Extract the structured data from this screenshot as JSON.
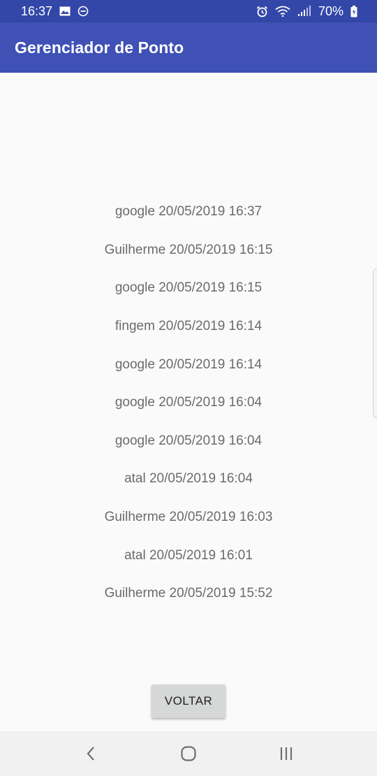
{
  "status_bar": {
    "time": "16:37",
    "battery": "70%",
    "icons": [
      "gallery-icon",
      "do-not-disturb-icon",
      "alarm-icon",
      "wifi-icon",
      "signal-icon",
      "battery-icon"
    ]
  },
  "app_bar": {
    "title": "Gerenciador de Ponto",
    "color": "#3f51b5"
  },
  "records": [
    "google 20/05/2019 16:37",
    "Guilherme 20/05/2019 16:15",
    "google 20/05/2019 16:15",
    "fingem 20/05/2019 16:14",
    "google 20/05/2019 16:14",
    "google 20/05/2019 16:04",
    "google 20/05/2019 16:04",
    "atal 20/05/2019 16:04",
    "Guilherme 20/05/2019 16:03",
    "atal 20/05/2019 16:01",
    "Guilherme 20/05/2019 15:52"
  ],
  "back_button": {
    "label": "VOLTAR"
  },
  "nav_bar": {
    "buttons": [
      "back-icon",
      "home-icon",
      "recents-icon"
    ]
  }
}
